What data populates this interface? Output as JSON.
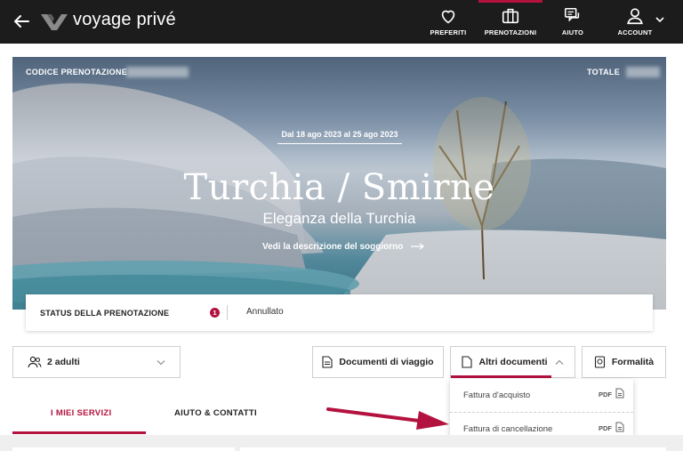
{
  "header": {
    "logo_text": "voyage privé",
    "nav": [
      {
        "label": "PREFERITI",
        "icon": "heart-icon"
      },
      {
        "label": "PRENOTAZIONI",
        "icon": "suitcase-icon",
        "active": true
      },
      {
        "label": "AIUTO",
        "icon": "chat-icon"
      },
      {
        "label": "ACCOUNT",
        "icon": "user-icon"
      }
    ]
  },
  "hero": {
    "booking_code_label": "CODICE PRENOTAZIONE",
    "total_label": "TOTALE",
    "dates": "Dal 18 ago 2023 al 25 ago 2023",
    "title": "Turchia / Smirne",
    "subtitle": "Eleganza della Turchia",
    "description_link": "Vedi la descrizione del soggiorno"
  },
  "status": {
    "label": "STATUS DELLA PRENOTAZIONE",
    "badge": "1",
    "value": "Annullato"
  },
  "actions": {
    "guests": "2 adulti",
    "travel_documents": "Documenti di viaggio",
    "other_documents": "Altri documenti",
    "formalities": "Formalità"
  },
  "dropdown": {
    "items": [
      {
        "label": "Fattura d'acquisto",
        "tag": "PDF"
      },
      {
        "label": "Fattura di cancellazione",
        "tag": "PDF"
      }
    ]
  },
  "tabs": [
    {
      "label": "I MIEI SERVIZI",
      "active": true
    },
    {
      "label": "AIUTO & CONTATTI"
    }
  ],
  "colors": {
    "accent": "#b3123f",
    "topbar": "#1c1c1c"
  }
}
